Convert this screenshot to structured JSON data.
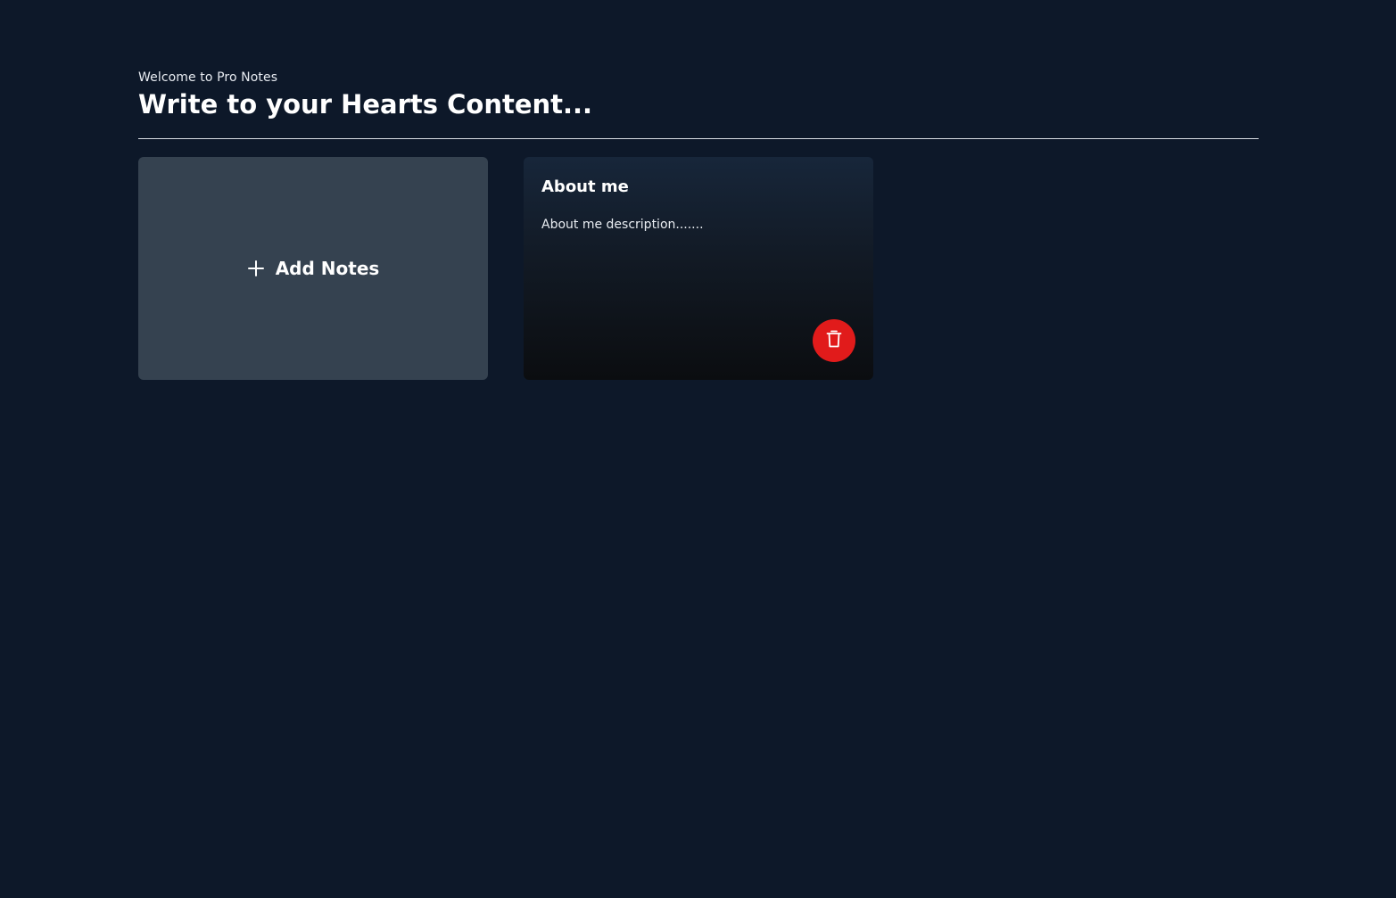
{
  "header": {
    "welcome": "Welcome to Pro Notes",
    "title": "Write to your Hearts Content..."
  },
  "add_card": {
    "label": "Add Notes",
    "icon": "plus-icon"
  },
  "notes": [
    {
      "title": "About me",
      "description": "About me description.......",
      "delete_icon": "trash-icon"
    }
  ],
  "colors": {
    "background": "#0d1829",
    "add_card": "#354250",
    "delete_button": "#e11b1b",
    "text": "#ffffff"
  }
}
